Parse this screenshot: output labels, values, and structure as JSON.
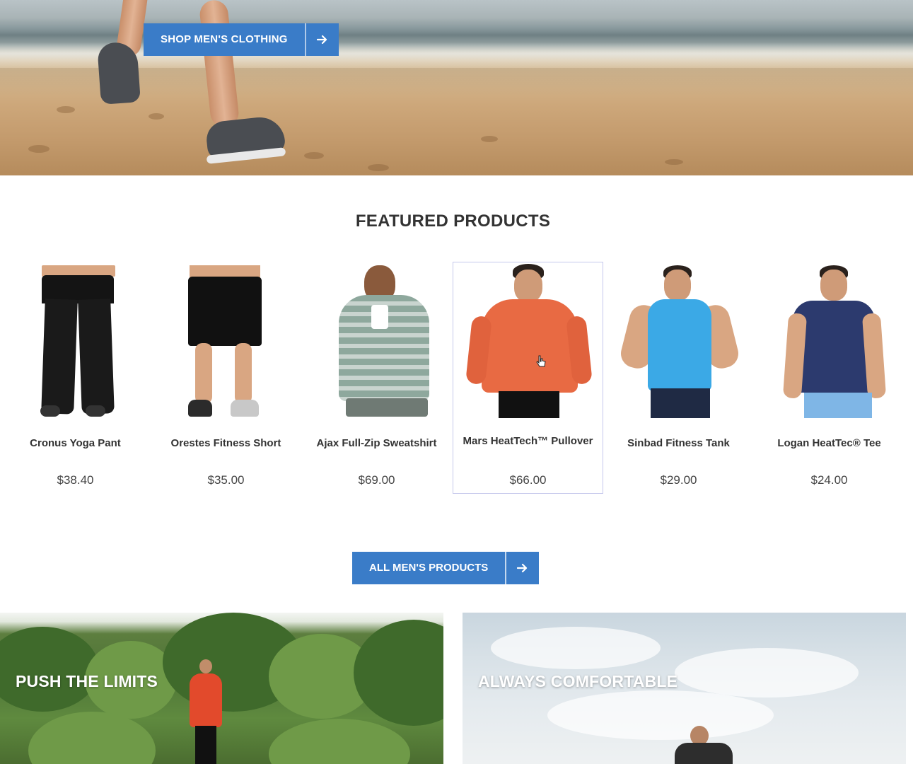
{
  "hero": {
    "button_label": "SHOP MEN'S CLOTHING",
    "arrow_icon": "arrow-right-icon"
  },
  "featured": {
    "title": "FEATURED PRODUCTS",
    "products": [
      {
        "name": "Cronus Yoga Pant",
        "price": "$38.40"
      },
      {
        "name": "Orestes Fitness Short",
        "price": "$35.00"
      },
      {
        "name": "Ajax Full-Zip Sweatshirt",
        "price": "$69.00"
      },
      {
        "name": "Mars HeatTech™ Pullover",
        "price": "$66.00"
      },
      {
        "name": "Sinbad Fitness Tank",
        "price": "$29.00"
      },
      {
        "name": "Logan HeatTec® Tee",
        "price": "$24.00"
      }
    ],
    "all_button_label": "ALL MEN'S PRODUCTS"
  },
  "promos": {
    "left_title": "PUSH THE LIMITS",
    "right_title": "ALWAYS COMFORTABLE"
  },
  "colors": {
    "accent": "#3a7cc8",
    "hover_border": "#c5c8ec"
  }
}
